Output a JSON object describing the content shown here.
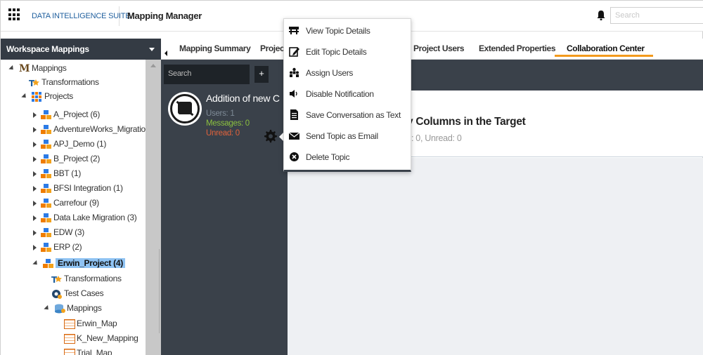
{
  "header": {
    "suite_title": "DATA INTELLIGENCE SUITE",
    "module_title": "Mapping Manager",
    "search_placeholder": "Search"
  },
  "workspace": {
    "title": "Workspace Mappings"
  },
  "tree": {
    "root": "Mappings",
    "transformations": "Transformations",
    "projects": "Projects",
    "project_items": [
      "A_Project (6)",
      "AdventureWorks_Migration (",
      "APJ_Demo (1)",
      "B_Project (2)",
      "BBT (1)",
      "BFSI Integration (1)",
      "Carrefour (9)",
      "Data Lake Migration (3)",
      "EDW (3)",
      "ERP (2)"
    ],
    "selected_project": "Erwin_Project (4)",
    "selected_children": {
      "transformations": "Transformations",
      "test_cases": "Test Cases",
      "mappings": "Mappings",
      "maps": [
        "Erwin_Map",
        "K_New_Mapping",
        "Trial_Map"
      ]
    }
  },
  "tabs": [
    {
      "label": "Mapping Summary"
    },
    {
      "label": "Project"
    },
    {
      "label": "Project Users"
    },
    {
      "label": "Extended Properties"
    },
    {
      "label": "Collaboration Center"
    }
  ],
  "topics": {
    "search_placeholder": "Search",
    "add_label": "+",
    "item": {
      "title": "Addition of new C",
      "users": "Users: 1",
      "messages": "Messages: 0",
      "unread": "Unread: 0"
    }
  },
  "detail": {
    "title": "y Columns in the Target",
    "subtitle": "s: 0, Unread: 0"
  },
  "context_menu": {
    "items": [
      {
        "label": "View Topic Details",
        "icon": "view-details-icon"
      },
      {
        "label": "Edit Topic Details",
        "icon": "edit-icon"
      },
      {
        "label": "Assign Users",
        "icon": "users-icon"
      },
      {
        "label": "Disable Notification",
        "icon": "speaker-icon"
      },
      {
        "label": "Save Conversation as Text",
        "icon": "document-icon"
      },
      {
        "label": "Send Topic as Email",
        "icon": "envelope-icon"
      },
      {
        "label": "Delete Topic",
        "icon": "delete-icon"
      }
    ]
  },
  "colors": {
    "dark_panel": "#3a414a",
    "accent_tab": "#f39a1c",
    "selected_node": "#8fc3f3",
    "brand_blue": "#1f5f9e"
  }
}
